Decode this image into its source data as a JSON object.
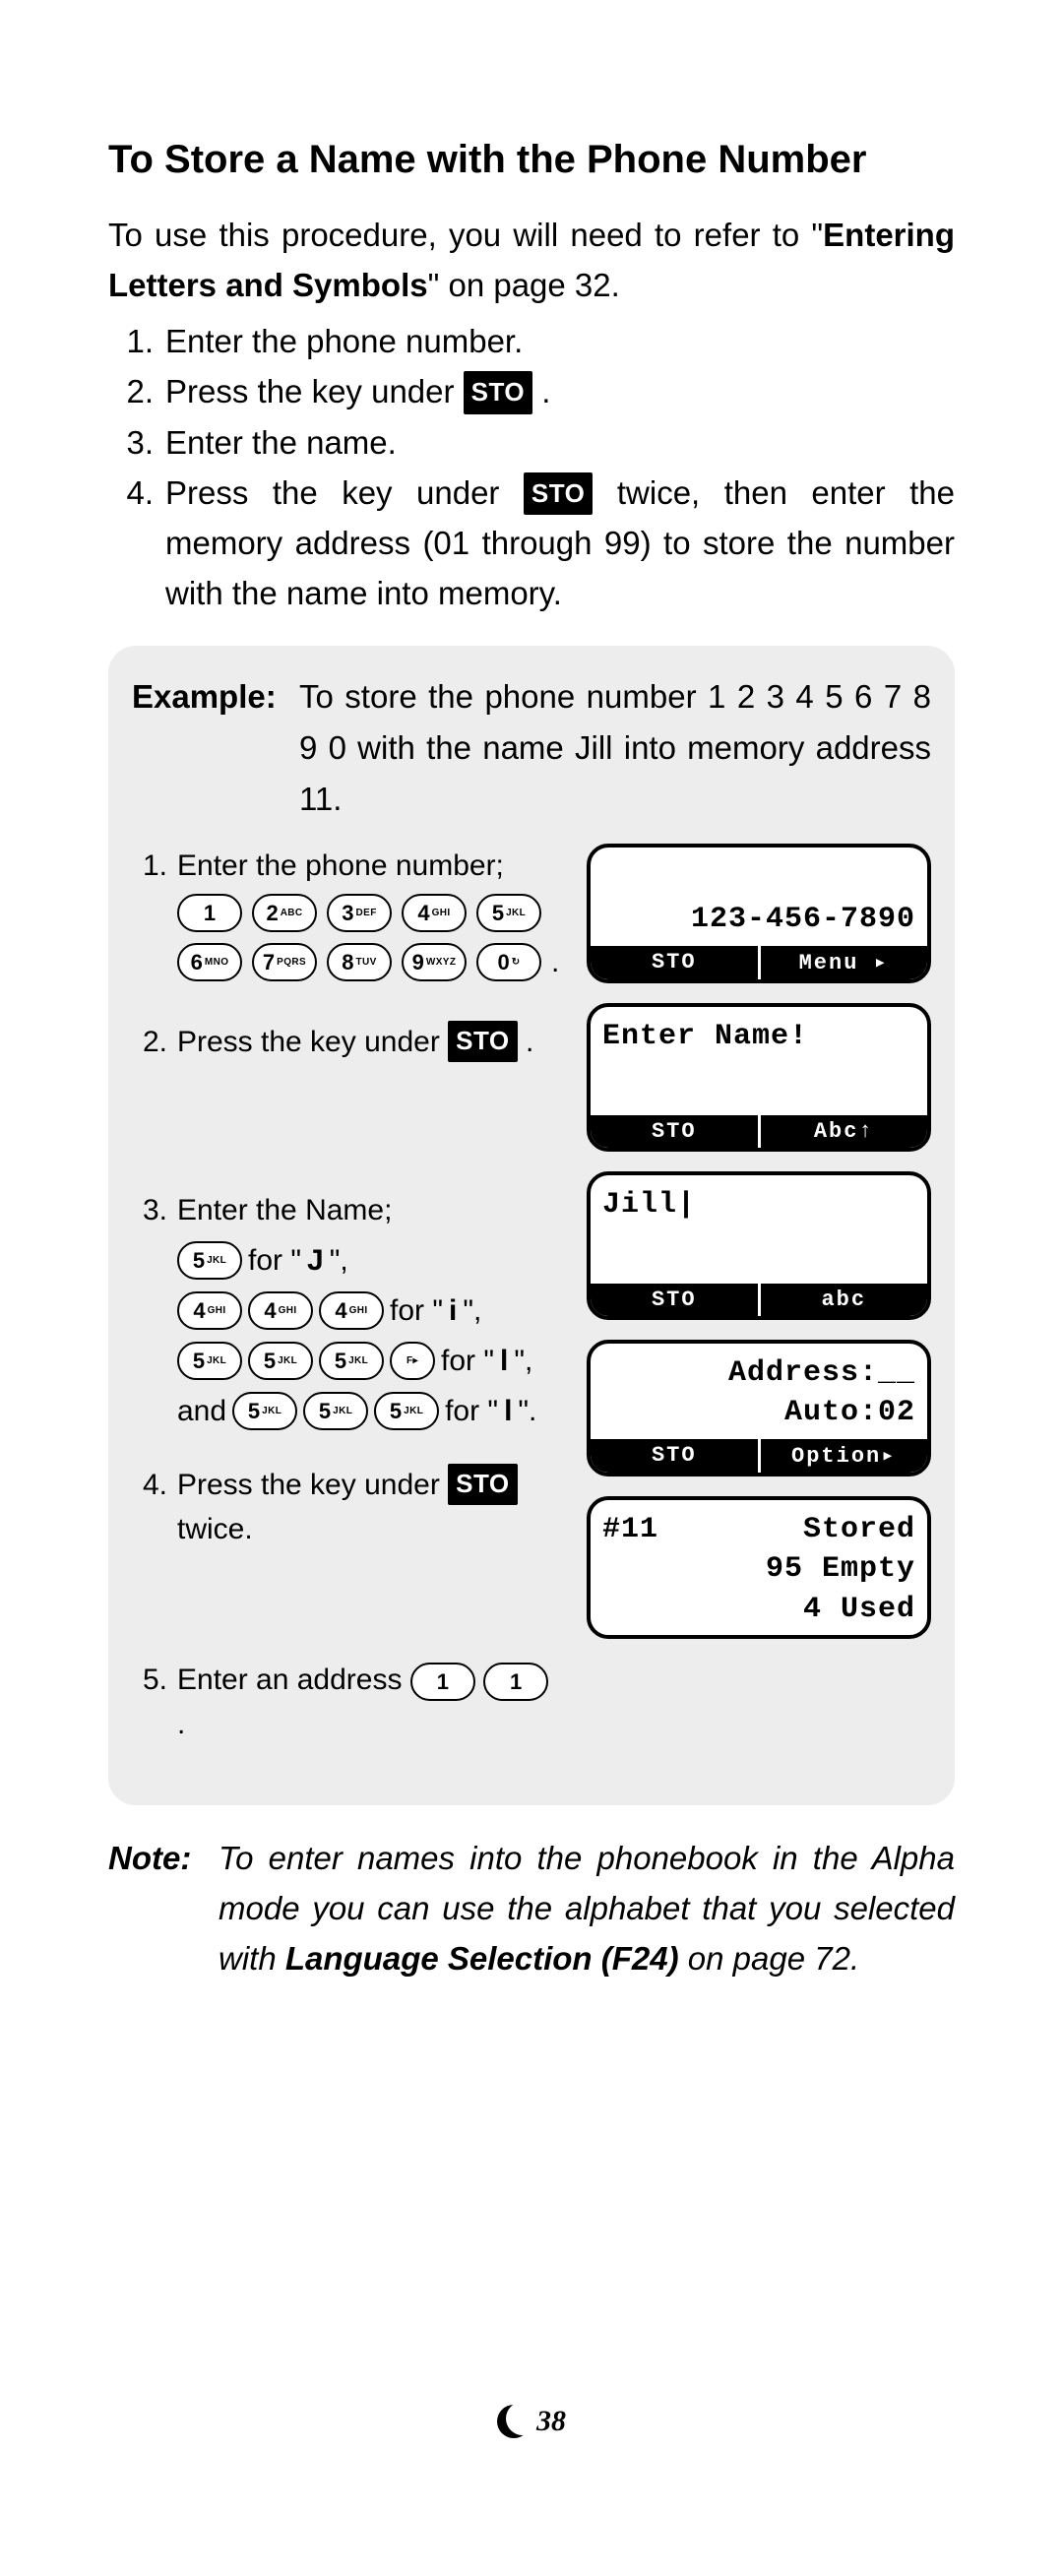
{
  "heading": "To Store a Name with the Phone Number",
  "intro_1": "To use this procedure, you will need to refer to \"",
  "intro_b": "Entering Letters and Symbols",
  "intro_2": "\" on page 32.",
  "sto_label": "STO",
  "step1": "Enter the phone number.",
  "step2a": "Press the key under ",
  "step2b": " .",
  "step3": "Enter the name.",
  "step4a": "Press the key under ",
  "step4b": " twice, then enter the memory address (01 through 99) to store the number with the name into memory.",
  "ex_label": "Example:",
  "ex_text": "To store the phone number 1 2 3 4 5 6 7 8 9 0 with the name Jill into memory address 11.",
  "ex1": "Enter the phone number;",
  "ex2a": "Press the key under ",
  "ex2b": " .",
  "ex3": "Enter the Name;",
  "ex3_j_for": " for \" ",
  "ex3_j_ltr": "J",
  "ex3_j_end": " \",",
  "ex3_i_for": " for \" ",
  "ex3_i_ltr": "i",
  "ex3_i_end": " \",",
  "ex3_l1_for": "for \" ",
  "ex3_l1_ltr": "l",
  "ex3_l1_end": " \",",
  "ex3_and": "and ",
  "ex3_l2_for": " for \" ",
  "ex3_l2_ltr": "l",
  "ex3_l2_end": " \".",
  "ex4a": "Press the key under ",
  "ex4b": " twice.",
  "ex5a": "Enter an address ",
  "ex5b": " .",
  "keys": {
    "k1": "1",
    "k2": "2",
    "k2s": "ABC",
    "k3": "3",
    "k3s": "DEF",
    "k4": "4",
    "k4s": "GHI",
    "k5": "5",
    "k5s": "JKL",
    "k6": "6",
    "k6s": "MNO",
    "k7": "7",
    "k7s": "PQRS",
    "k8": "8",
    "k8s": "TUV",
    "k9": "9",
    "k9s": "WXYZ",
    "k0": "0",
    "k0s": "↻",
    "kf": "F▸"
  },
  "lcd1": {
    "line": "123-456-7890",
    "left": "STO",
    "right": "Menu ▸"
  },
  "lcd2": {
    "line": "Enter Name!",
    "left": "STO",
    "right": "Abc↑"
  },
  "lcd3": {
    "line": "Jill|",
    "left": "STO",
    "right": "abc"
  },
  "lcd4": {
    "l1": "Address:__",
    "l2": "Auto:02",
    "left": "STO",
    "right": "Option▸"
  },
  "lcd5": {
    "l1a": "#11",
    "l1b": "Stored",
    "l2": "95 Empty",
    "l3": "4 Used"
  },
  "note_lbl": "Note:",
  "note_1": "To enter names into the phonebook in the Alpha mode you can use the alphabet that you selected with ",
  "note_b": "Language Selection (F24)",
  "note_2": " on page 72.",
  "page_number": "38"
}
